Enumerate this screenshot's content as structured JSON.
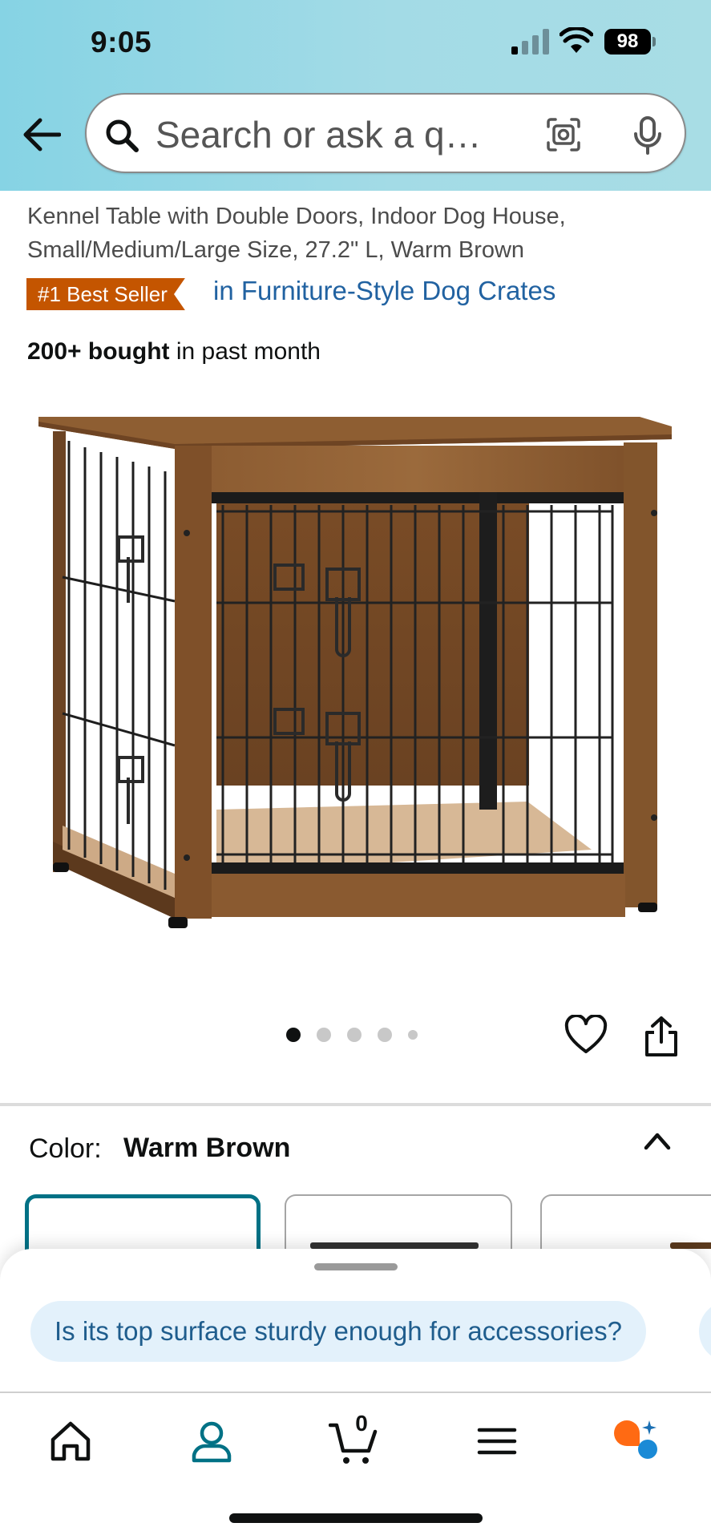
{
  "status_bar": {
    "time": "9:05",
    "battery": "98"
  },
  "search": {
    "placeholder": "Search or ask a q…"
  },
  "product": {
    "title_lines": [
      "Kennel Table with Double Doors, Indoor Dog House,",
      "Small/Medium/Large Size, 27.2\" L, Warm Brown"
    ],
    "badge": "#1 Best Seller",
    "badge_category": "in Furniture-Style Dog Crates",
    "bought_bold": "200+ bought",
    "bought_rest": " in past month"
  },
  "color": {
    "label": "Color:",
    "value": "Warm Brown"
  },
  "suggestion": {
    "question": "Is its top surface sturdy enough for accessories?"
  },
  "cart": {
    "count": "0"
  },
  "colors": {
    "accent": "#007185",
    "badge": "#c45500",
    "link": "#2162a1",
    "header": "#a3dbe6"
  }
}
